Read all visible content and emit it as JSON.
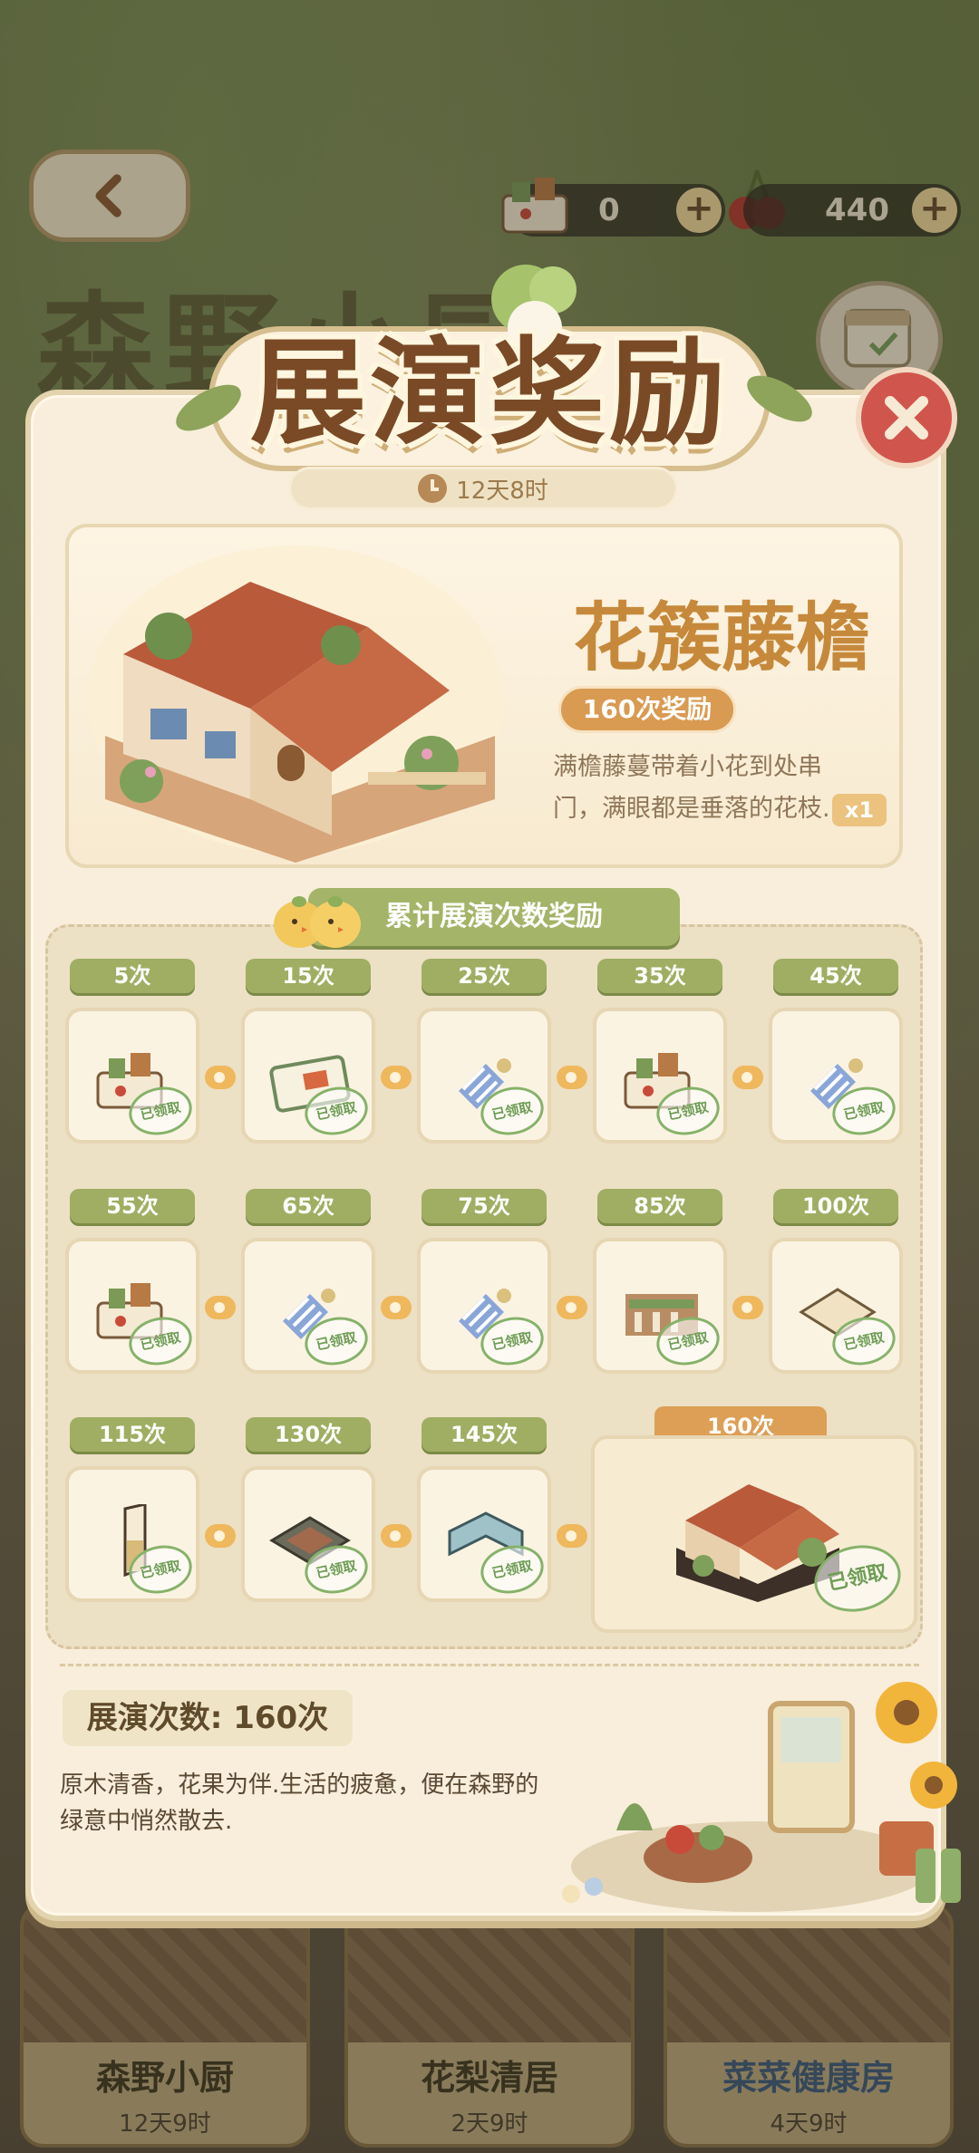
{
  "resources": {
    "currency1_value": "0",
    "cherry_value": "440"
  },
  "background": {
    "title": "森野小厨"
  },
  "dialog": {
    "title": "展演奖励",
    "timer": "12天8时",
    "close_icon": "close-icon"
  },
  "featured": {
    "name": "花簇藤檐",
    "badge": "160次奖励",
    "description": "满檐藤蔓带着小花到处串门，满眼都是垂落的花枝.",
    "quantity": "x1"
  },
  "cumulative": {
    "heading": "累计展演次数奖励",
    "claimed_stamp": "已领取",
    "tiers": [
      {
        "label": "5次",
        "item": "bundle"
      },
      {
        "label": "15次",
        "item": "ticket"
      },
      {
        "label": "25次",
        "item": "fabric"
      },
      {
        "label": "35次",
        "item": "bundle"
      },
      {
        "label": "45次",
        "item": "fabric"
      },
      {
        "label": "55次",
        "item": "bundle"
      },
      {
        "label": "65次",
        "item": "fabric"
      },
      {
        "label": "75次",
        "item": "fabric"
      },
      {
        "label": "85次",
        "item": "fence"
      },
      {
        "label": "100次",
        "item": "floor"
      },
      {
        "label": "115次",
        "item": "wallpaper"
      },
      {
        "label": "130次",
        "item": "tile-floor"
      },
      {
        "label": "145次",
        "item": "wall-corner"
      },
      {
        "label": "160次",
        "item": "house"
      }
    ]
  },
  "footer": {
    "count_label": "展演次数: 160次",
    "flavor": "原木清香，花果为伴.生活的疲惫，便在森野的绿意中悄然散去."
  },
  "house_cards": [
    {
      "name": "森野小厨",
      "time": "12天9时"
    },
    {
      "name": "花梨清居",
      "time": "2天9时"
    },
    {
      "name": "菜菜健康房",
      "time": "4天9时"
    }
  ],
  "colors": {
    "panel_bg": "#f8eedb",
    "title_brown": "#7a4a26",
    "accent_orange": "#d99a51",
    "tier_green": "#9fae62",
    "close_red": "#d0564d"
  }
}
